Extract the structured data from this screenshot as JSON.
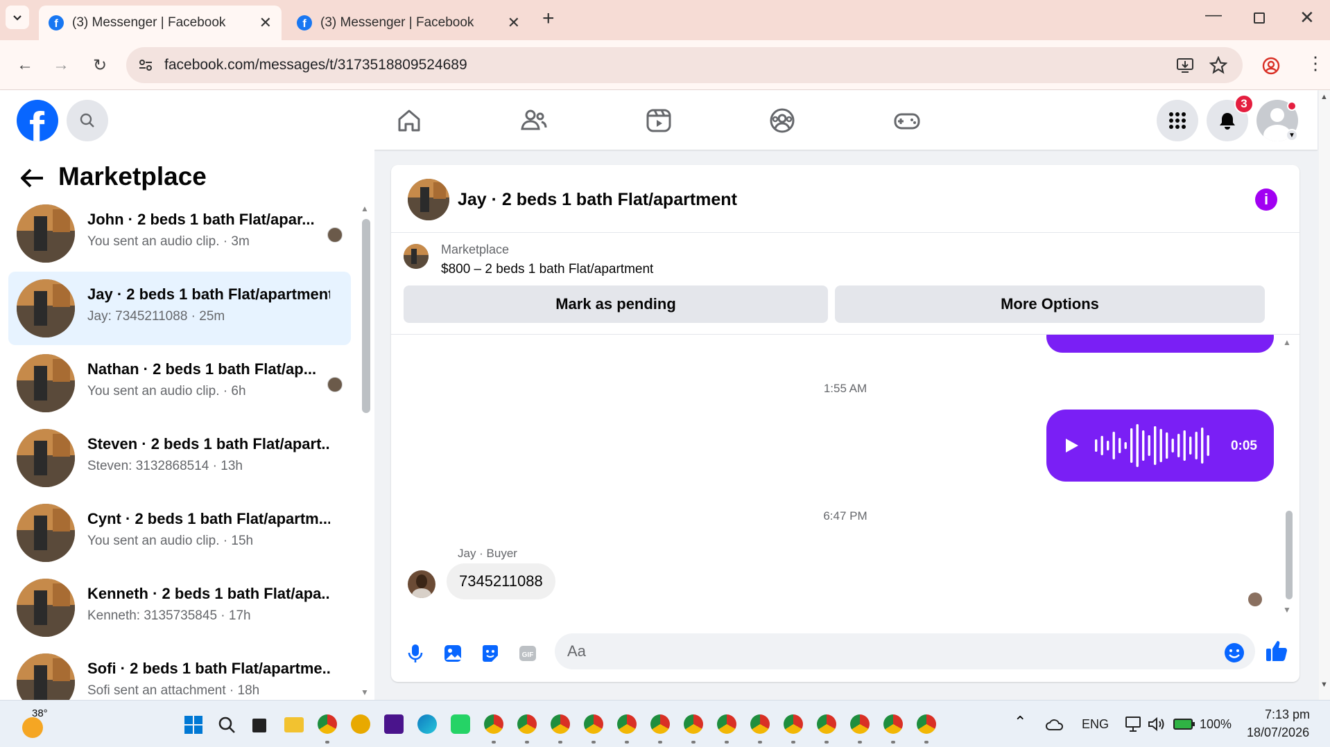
{
  "browser": {
    "tabs": [
      {
        "title": "(3) Messenger | Facebook",
        "active": true
      },
      {
        "title": "(3) Messenger | Facebook",
        "active": false
      }
    ],
    "url": "facebook.com/messages/t/3173518809524689"
  },
  "fb_header": {
    "notification_count": "3",
    "nav_icons": [
      "home-icon",
      "friends-icon",
      "video-icon",
      "groups-icon",
      "gaming-icon"
    ]
  },
  "left_panel": {
    "title": "Marketplace",
    "conversations": [
      {
        "name": "John · 2 beds 1 bath Flat/apar...",
        "preview": "You sent an audio clip. · 3m",
        "selected": false,
        "seen": true
      },
      {
        "name": "Jay · 2 beds 1 bath Flat/apartment",
        "preview": "Jay: 7345211088 · 25m",
        "selected": true,
        "seen": false
      },
      {
        "name": "Nathan · 2 beds 1 bath Flat/ap...",
        "preview": "You sent an audio clip. · 6h",
        "selected": false,
        "seen": true
      },
      {
        "name": "Steven · 2 beds 1 bath Flat/apart...",
        "preview": "Steven: 3132868514 · 13h",
        "selected": false,
        "seen": false
      },
      {
        "name": "Cynt · 2 beds 1 bath Flat/apartm...",
        "preview": "You sent an audio clip. · 15h",
        "selected": false,
        "seen": false
      },
      {
        "name": "Kenneth · 2 beds 1 bath Flat/apa...",
        "preview": "Kenneth: 3135735845 · 17h",
        "selected": false,
        "seen": false
      },
      {
        "name": "Sofi · 2 beds 1 bath Flat/apartme...",
        "preview": "Sofi sent an attachment · 18h",
        "selected": false,
        "seen": false
      }
    ]
  },
  "chat": {
    "title": "Jay · 2 beds 1 bath Flat/apartment",
    "marketplace_label": "Marketplace",
    "listing": "$800 – 2 beds 1 bath Flat/apartment",
    "mark_pending": "Mark as pending",
    "more_options": "More Options",
    "time1": "1:55 AM",
    "audio_duration": "0:05",
    "time2": "6:47 PM",
    "sender": "Jay · Buyer",
    "message": "7345211088",
    "composer_placeholder": "Aa",
    "accent_color": "#7a1ff5"
  },
  "taskbar": {
    "weather": "38°",
    "language": "ENG",
    "battery": "100%",
    "time": "7:13 pm",
    "date": "18/07/2026"
  }
}
